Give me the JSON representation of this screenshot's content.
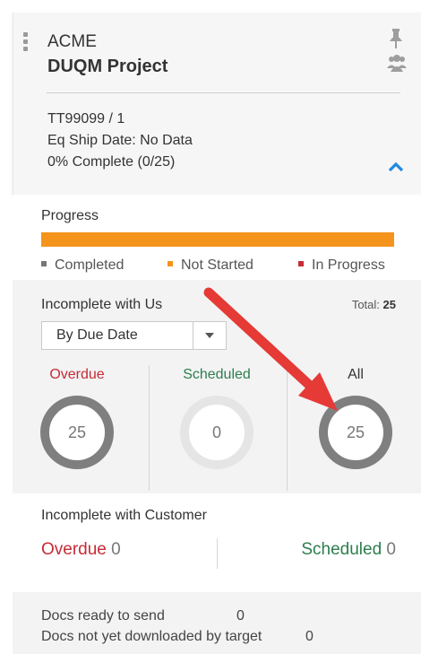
{
  "header": {
    "client": "ACME",
    "project": "DUQM Project",
    "job": "TT99099 / 1",
    "ship_date": "Eq Ship Date: No Data",
    "complete": "0% Complete (0/25)"
  },
  "progress": {
    "title": "Progress",
    "completed_fraction": 0.0,
    "not_started_fraction": 1.0,
    "legend": [
      {
        "label": "Completed",
        "color": "#777777"
      },
      {
        "label": "Not Started",
        "color": "#f5941d"
      },
      {
        "label": "In Progress",
        "color": "#c62b36"
      }
    ]
  },
  "incomplete_us": {
    "title": "Incomplete with Us",
    "total_label": "Total:",
    "total_value": "25",
    "sort_value": "By Due Date",
    "overdue": {
      "label": "Overdue",
      "value": "25"
    },
    "scheduled": {
      "label": "Scheduled",
      "value": "0"
    },
    "all": {
      "label": "All",
      "value": "25"
    }
  },
  "incomplete_customer": {
    "title": "Incomplete with Customer",
    "overdue_label": "Overdue",
    "overdue_value": "0",
    "scheduled_label": "Scheduled",
    "scheduled_value": "0"
  },
  "docs": {
    "ready_label": "Docs ready to send",
    "ready_value": "0",
    "not_downloaded_label": "Docs not yet downloaded by target",
    "not_downloaded_value": "0"
  },
  "colors": {
    "accent": "#f5941d",
    "overdue": "#c62b36",
    "scheduled": "#2e7d4f",
    "chevron": "#1e88e5",
    "annotation_arrow": "#e53a35"
  },
  "icons": [
    "drag-handle-icon",
    "pin-icon",
    "users-icon",
    "chevron-up-icon",
    "chevron-down-icon"
  ]
}
